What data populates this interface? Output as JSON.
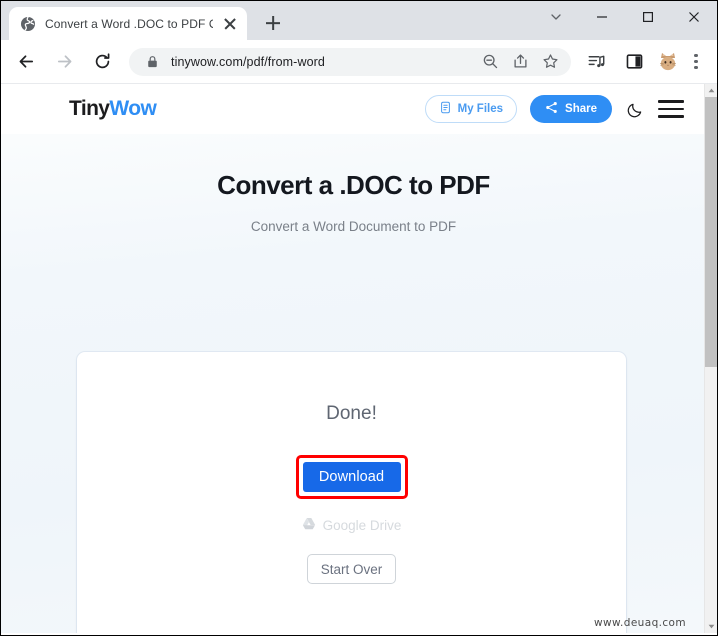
{
  "browser": {
    "tab": {
      "favicon_icon": "globe-icon",
      "title": "Convert a Word .DOC to PDF Onl",
      "close_icon": "close-icon"
    },
    "new_tab_icon": "plus-icon",
    "window_controls": {
      "tab_search_icon": "chevron-down-icon",
      "minimize_icon": "minimize-icon",
      "maximize_icon": "maximize-icon",
      "close_icon": "close-icon"
    },
    "toolbar": {
      "back_icon": "back-arrow-icon",
      "forward_icon": "forward-arrow-icon",
      "reload_icon": "reload-icon",
      "lock_icon": "lock-icon",
      "url": "tinywow.com/pdf/from-word",
      "zoom_icon": "zoom-out-icon",
      "share_icon": "share-page-icon",
      "bookmark_icon": "star-icon",
      "media_icon": "media-playlist-icon",
      "side_panel_icon": "side-panel-icon",
      "profile_icon": "cat-avatar-icon",
      "menu_icon": "three-dots-menu-icon"
    }
  },
  "site": {
    "logo": {
      "part1": "Tiny",
      "part2": "Wow"
    },
    "header": {
      "my_files_label": "My Files",
      "my_files_icon": "document-icon",
      "share_label": "Share",
      "share_icon": "share-icon",
      "dark_mode_icon": "moon-icon",
      "menu_icon": "hamburger-menu-icon"
    },
    "hero": {
      "title": "Convert a .DOC to PDF",
      "subtitle": "Convert a Word Document to PDF"
    },
    "card": {
      "status": "Done!",
      "download_label": "Download",
      "google_drive_label": "Google Drive",
      "google_drive_icon": "google-drive-icon",
      "start_over_label": "Start Over"
    }
  },
  "watermark": "www.deuaq.com",
  "colors": {
    "brand_blue": "#2f8ef4",
    "download_blue": "#1769e8",
    "highlight_red": "#ff0000",
    "page_background": "#f2f7fb"
  },
  "scrollbar": {
    "up_arrow_icon": "scroll-up-arrow-icon",
    "down_arrow_icon": "scroll-down-arrow-icon",
    "thumb": "scrollbar-thumb"
  }
}
